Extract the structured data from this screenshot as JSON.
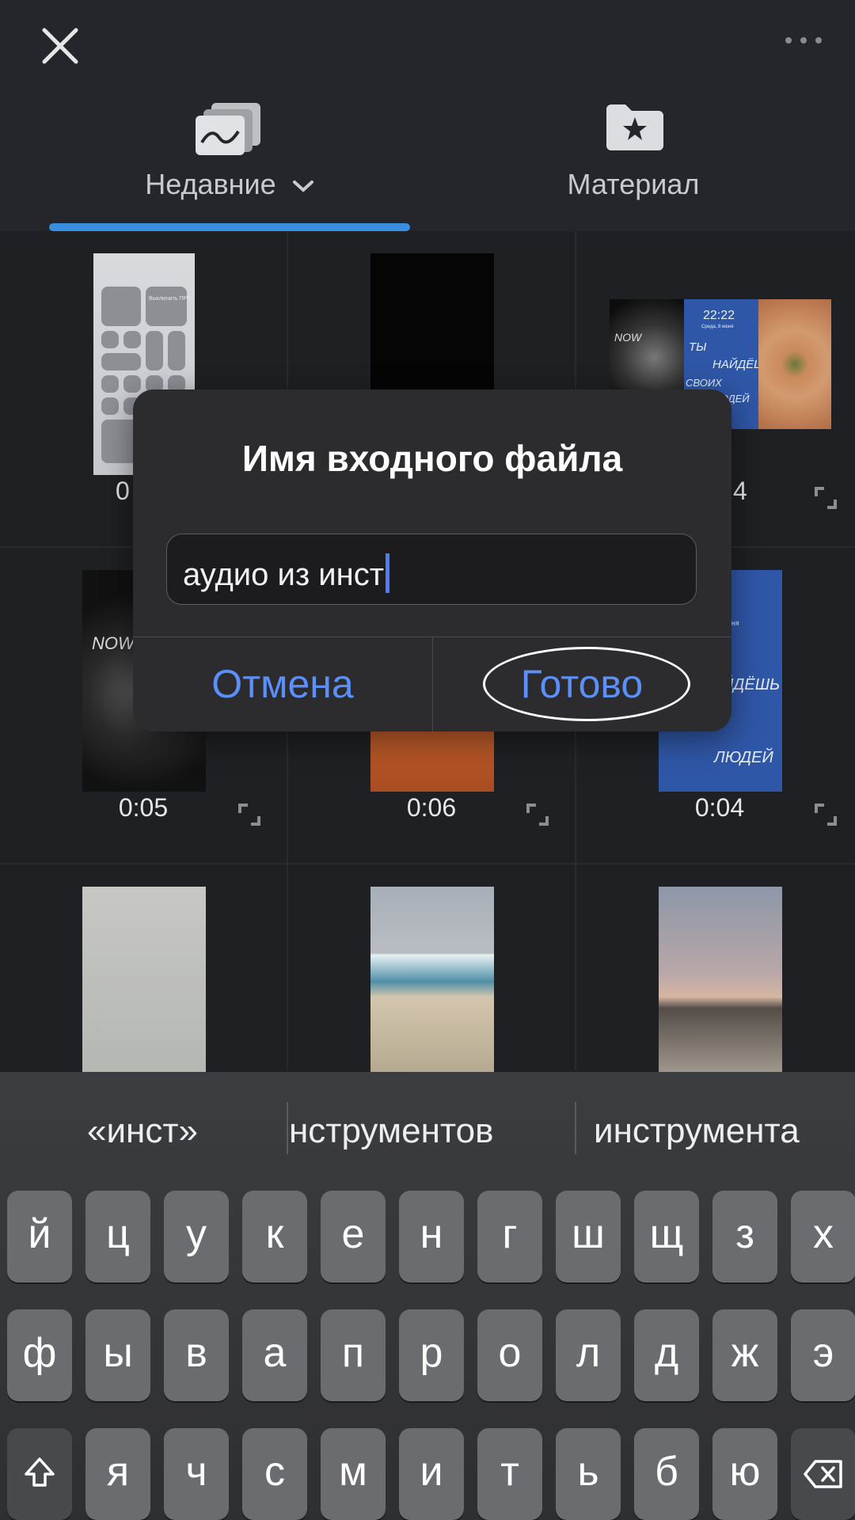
{
  "header": {
    "close_icon": "close-icon",
    "more_icon": "more-icon",
    "tabs": [
      {
        "label": "Недавние",
        "icon": "recent-media-icon",
        "active": true
      },
      {
        "label": "Материал",
        "icon": "star-folder-icon",
        "active": false
      }
    ],
    "accent_color": "#3a8ee0"
  },
  "grid": {
    "items": [
      {
        "duration": "0"
      },
      {
        "duration": ""
      },
      {
        "duration": "4"
      },
      {
        "duration": "0:05"
      },
      {
        "duration": "0:06"
      },
      {
        "duration": "0:04"
      },
      {
        "duration": ""
      },
      {
        "duration": ""
      },
      {
        "duration": ""
      }
    ],
    "thumb_texts": {
      "phone_left_top": "Выключить ПРО",
      "collage_time": "22:22",
      "collage_date": "Среда, 8 июня",
      "collage_line1": "ТЫ",
      "collage_line2": "НАЙДЁШЬ",
      "collage_line3": "СВОИХ",
      "collage_line4": "ЛЮДЕЙ",
      "now_tag": "NOW",
      "blue_time": "22",
      "blue_date": "июня",
      "blue_line1": "ЙДЁШЬ",
      "blue_line2": "ЛЮДЕЙ"
    }
  },
  "dialog": {
    "title": "Имя входного файла",
    "input_value": "аудио из инст",
    "cancel_label": "Отмена",
    "done_label": "Готово",
    "button_color": "#5b8ff9"
  },
  "keyboard": {
    "suggestions": [
      "«инст»",
      "нструментов",
      "инструмента"
    ],
    "row1": [
      "й",
      "ц",
      "у",
      "к",
      "е",
      "н",
      "г",
      "ш",
      "щ",
      "з",
      "х"
    ],
    "row2": [
      "ф",
      "ы",
      "в",
      "а",
      "п",
      "р",
      "о",
      "л",
      "д",
      "ж",
      "э"
    ],
    "row3": [
      "я",
      "ч",
      "с",
      "м",
      "и",
      "т",
      "ь",
      "б",
      "ю"
    ],
    "shift_icon": "shift-icon",
    "delete_icon": "backspace-icon"
  }
}
